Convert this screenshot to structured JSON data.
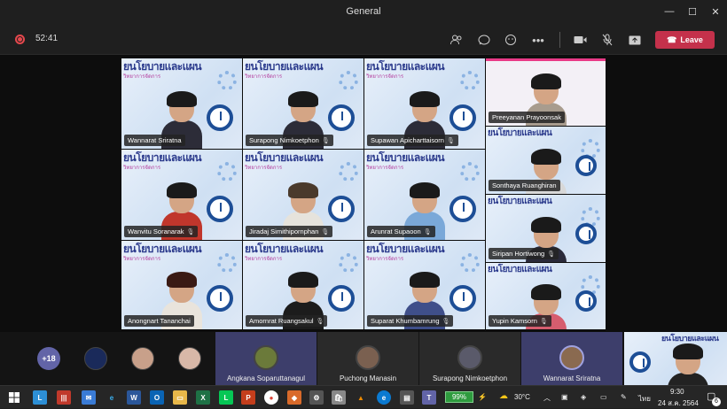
{
  "window": {
    "title": "General"
  },
  "toolbar": {
    "timer": "52:41",
    "leave_label": "Leave"
  },
  "banner_text": "ยนโยบายและแผน",
  "banner_sub": "วิทยาการจัดการ",
  "participants": [
    {
      "name": "Wannarat Sriratna",
      "mic": false
    },
    {
      "name": "Surapong Nimkoetphon",
      "mic": true
    },
    {
      "name": "Supawan Apicharttaisorn",
      "mic": true
    },
    {
      "name": "Preeyanan Prayoonsak",
      "mic": false
    },
    {
      "name": "Sonthaya Ruanghiran",
      "mic": false
    },
    {
      "name": "Wanvitu Soranarak",
      "mic": true
    },
    {
      "name": "Jiradaj Simithipornphan",
      "mic": true
    },
    {
      "name": "Arunrat Supaoon",
      "mic": true
    },
    {
      "name": "Siripan Hortiwong",
      "mic": true
    },
    {
      "name": "Anongnart Tananchai",
      "mic": false
    },
    {
      "name": "Amornrat Ruangsakul",
      "mic": true
    },
    {
      "name": "Suparat Khumbamrung",
      "mic": true
    },
    {
      "name": "Yupin Kamsorn",
      "mic": true
    }
  ],
  "strip": {
    "overflow_count": "+18",
    "tiles": [
      "Angkana Soparuttanagul",
      "Puchong Manasin",
      "Surapong Nimkoetphon",
      "Wannarat Sriratna"
    ]
  },
  "taskbar": {
    "battery": "99%",
    "weather": "30°C",
    "lang": "ไทย",
    "time": "9:30",
    "date": "24 ส.ค. 2564",
    "notifications": "6"
  },
  "colors": {
    "leave": "#c4314b",
    "accent": "#6264a7",
    "record": "#e5484d"
  }
}
